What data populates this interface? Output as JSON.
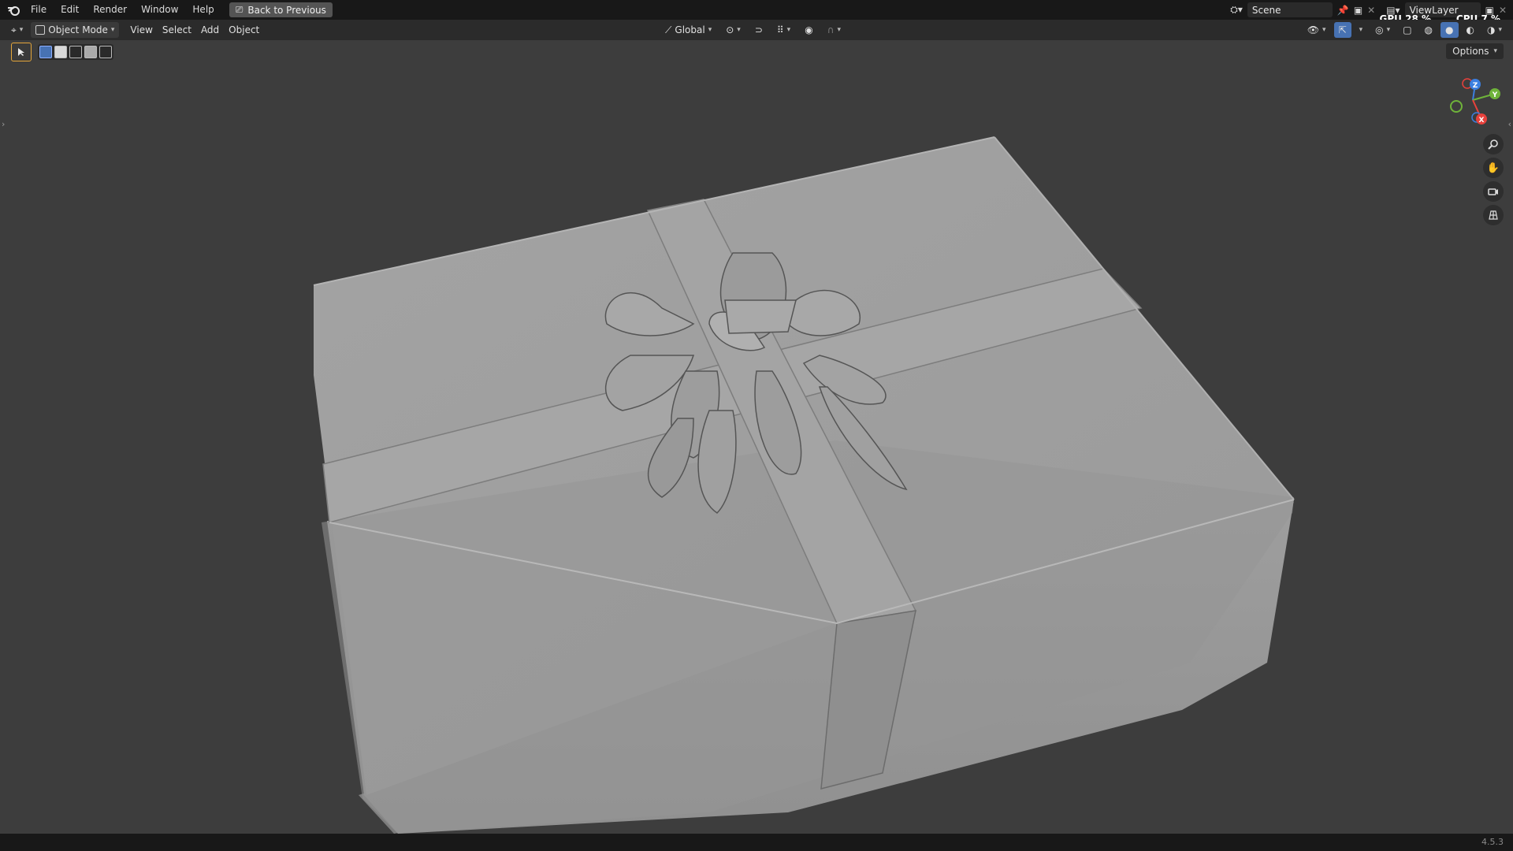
{
  "menu": {
    "items": [
      "File",
      "Edit",
      "Render",
      "Window",
      "Help"
    ],
    "back_button": "Back to Previous"
  },
  "top_right": {
    "scene": "Scene",
    "view_layer": "ViewLayer",
    "gpu_label": "GPU",
    "gpu_value": "28 %",
    "cpu_label": "CPU",
    "cpu_value": "7 %"
  },
  "header": {
    "mode": "Object Mode",
    "menus": [
      "View",
      "Select",
      "Add",
      "Object"
    ],
    "transform_orientation": "Global"
  },
  "viewport": {
    "options_label": "Options"
  },
  "gizmo": {
    "z": "Z",
    "y": "Y",
    "x": "X"
  },
  "status": {
    "version": "4.5.3"
  },
  "colors": {
    "background": "#3d3d3d",
    "topbar": "#181818",
    "header": "#2b2b2b",
    "accent": "#4772b3",
    "axis_x": "#e8413c",
    "axis_y": "#6fb33a",
    "axis_z": "#3b7fe0"
  }
}
